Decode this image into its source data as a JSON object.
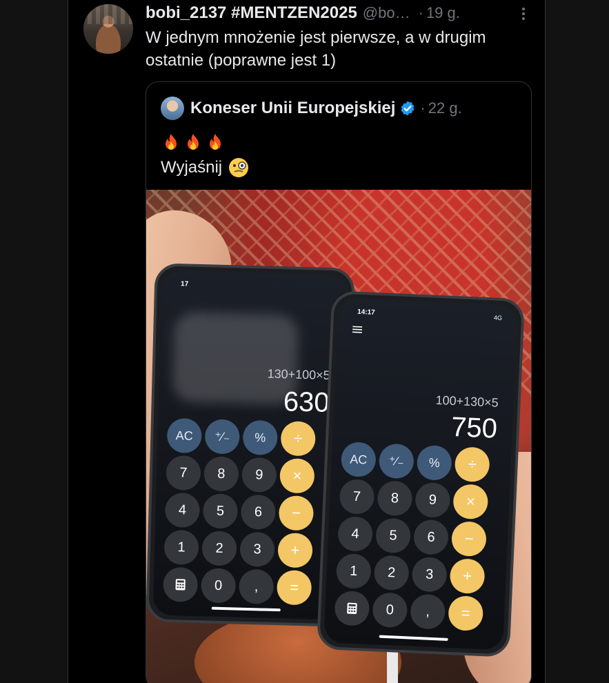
{
  "tweet": {
    "display_name": "bobi_2137 #MENTZEN2025",
    "handle": "@bo…",
    "separator": "·",
    "time": "19 g.",
    "text": "W jednym mnożenie jest pierwsze, a w drugim ostatnie (poprawne jest 1)"
  },
  "quote": {
    "display_name": "Koneser Unii Europejskiej",
    "separator": "·",
    "time": "22 g.",
    "emoji_line": "🔥🔥🔥",
    "text": "Wyjaśnij"
  },
  "phone_left": {
    "status_time": "17",
    "expression": "130+100×5",
    "result": "630",
    "keys": [
      "AC",
      "⁺∕₋",
      "%",
      "÷",
      "7",
      "8",
      "9",
      "×",
      "4",
      "5",
      "6",
      "−",
      "1",
      "2",
      "3",
      "+",
      "",
      "0",
      ",",
      "="
    ]
  },
  "phone_right": {
    "status_time": "14:17",
    "status_icons": "4G",
    "expression": "100+130×5",
    "result": "750",
    "keys": [
      "AC",
      "⁺∕₋",
      "%",
      "÷",
      "7",
      "8",
      "9",
      "×",
      "4",
      "5",
      "6",
      "−",
      "1",
      "2",
      "3",
      "+",
      "",
      "0",
      ",",
      "="
    ]
  },
  "colors": {
    "background": "#000000",
    "text_primary": "#e7e9ea",
    "text_secondary": "#71767b",
    "border": "#2f3336",
    "verified": "#1d9bf0",
    "operator_key": "#f3c766",
    "function_key": "#3f5978",
    "number_key": "#33363b"
  }
}
